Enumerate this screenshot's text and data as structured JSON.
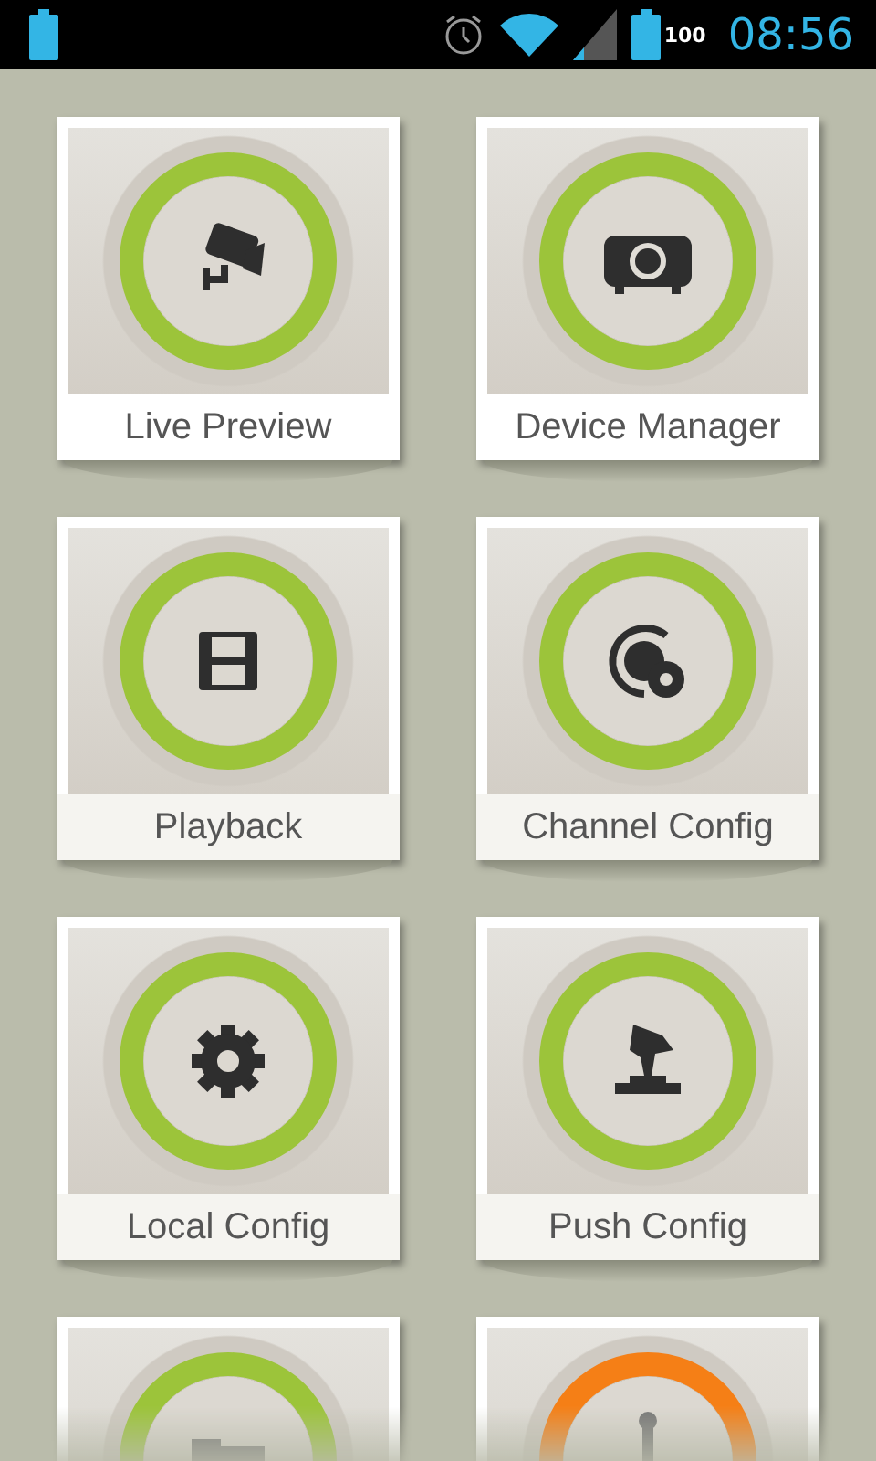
{
  "status_bar": {
    "battery_level": "100",
    "time": "08:56"
  },
  "tiles": [
    {
      "label": "Live Preview",
      "kind": "camera",
      "color": "#9cc43a"
    },
    {
      "label": "Device Manager",
      "kind": "projector",
      "color": "#9cc43a"
    },
    {
      "label": "Playback",
      "kind": "film",
      "color": "#9cc43a"
    },
    {
      "label": "Channel Config",
      "kind": "channel",
      "color": "#9cc43a"
    },
    {
      "label": "Local Config",
      "kind": "gear",
      "color": "#9cc43a"
    },
    {
      "label": "Push Config",
      "kind": "push",
      "color": "#9cc43a"
    },
    {
      "kind": "folder",
      "color": "#9cc43a"
    },
    {
      "kind": "dot",
      "color": "#f57f16"
    }
  ]
}
